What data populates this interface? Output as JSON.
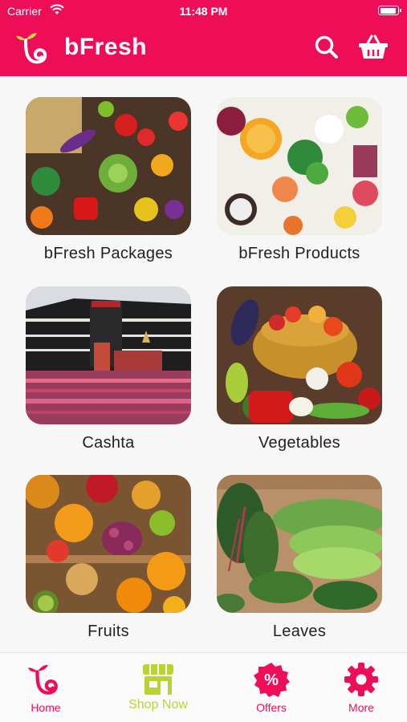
{
  "status_bar": {
    "carrier": "Carrier",
    "time": "11:48 PM"
  },
  "header": {
    "brand": "bFresh",
    "icons": [
      "logo-icon",
      "search-icon",
      "basket-icon"
    ]
  },
  "categories": [
    {
      "label": "bFresh Packages"
    },
    {
      "label": "bFresh Products"
    },
    {
      "label": "Cashta"
    },
    {
      "label": "Vegetables"
    },
    {
      "label": "Fruits"
    },
    {
      "label": "Leaves"
    }
  ],
  "tabs": [
    {
      "label": "Home",
      "icon": "home-logo-icon"
    },
    {
      "label": "Shop Now",
      "icon": "shop-icon"
    },
    {
      "label": "Offers",
      "icon": "percent-badge-icon"
    },
    {
      "label": "More",
      "icon": "gear-icon"
    }
  ],
  "colors": {
    "brand": "#ee0e58",
    "accent_green": "#b9d431",
    "background": "#f7f7f7"
  }
}
